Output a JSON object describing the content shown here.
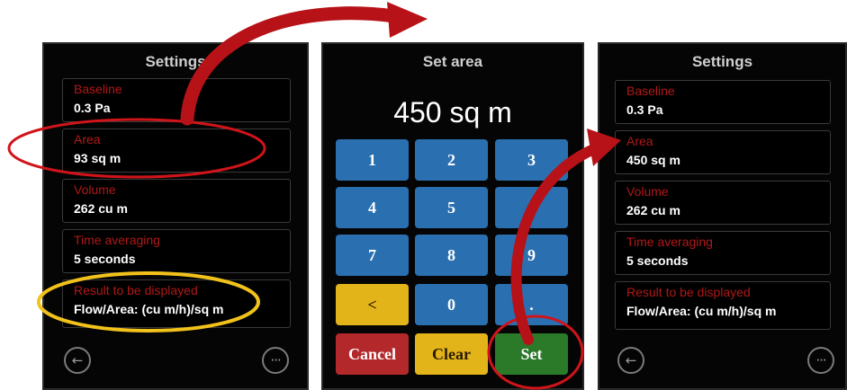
{
  "left_panel": {
    "title": "Settings",
    "settings": [
      {
        "label": "Baseline",
        "value": "0.3 Pa"
      },
      {
        "label": "Area",
        "value": "93 sq m"
      },
      {
        "label": "Volume",
        "value": "262 cu m"
      },
      {
        "label": "Time averaging",
        "value": "5 seconds"
      },
      {
        "label": "Result to be displayed",
        "value": "Flow/Area: (cu m/h)/sq m"
      }
    ],
    "back_symbol": "←",
    "more_symbol": "···"
  },
  "middle_panel": {
    "title": "Set area",
    "display_value": "450 sq m",
    "keys": [
      "1",
      "2",
      "3",
      "4",
      "5",
      "6",
      "7",
      "8",
      "9",
      "<",
      "0",
      "."
    ],
    "cancel_label": "Cancel",
    "clear_label": "Clear",
    "set_label": "Set"
  },
  "right_panel": {
    "title": "Settings",
    "settings": [
      {
        "label": "Baseline",
        "value": "0.3 Pa"
      },
      {
        "label": "Area",
        "value": "450 sq m"
      },
      {
        "label": "Volume",
        "value": "262 cu m"
      },
      {
        "label": "Time averaging",
        "value": "5 seconds"
      },
      {
        "label": "Result to be displayed",
        "value": "Flow/Area: (cu m/h)/sq m"
      }
    ],
    "back_symbol": "←",
    "more_symbol": "···"
  },
  "colors": {
    "panel_bg": "#050505",
    "label_red": "#b01818",
    "key_blue": "#2a6fb0",
    "key_yellow": "#e2b419",
    "key_red": "#b3282a",
    "key_green": "#2a7a2a",
    "annotation_red": "#d0141a",
    "annotation_yellow": "#f2c21b"
  }
}
